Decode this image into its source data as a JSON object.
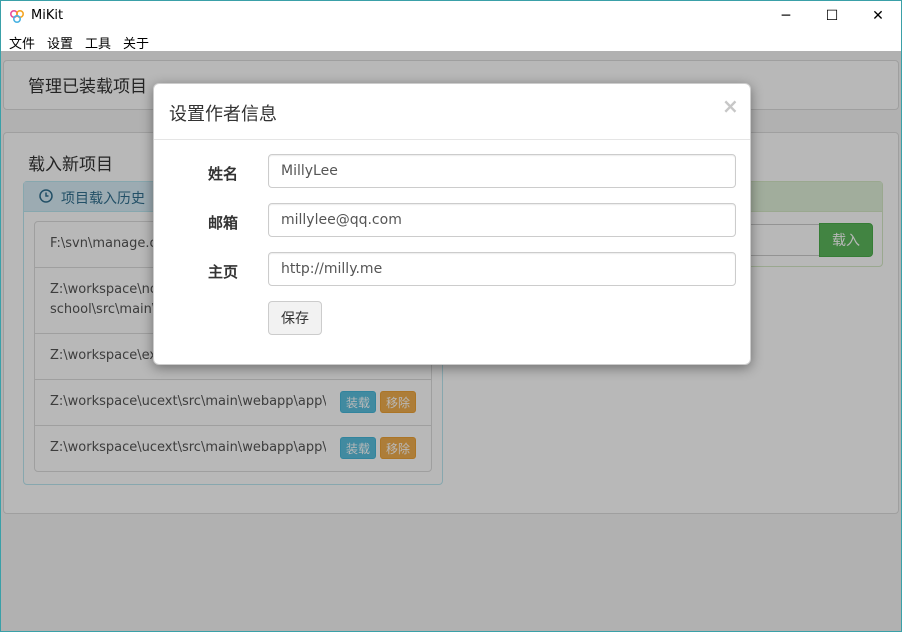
{
  "window": {
    "title": "MiKit",
    "controls": {
      "minimize": "─",
      "maximize": "☐",
      "close": "✕"
    }
  },
  "menubar": {
    "items": [
      "文件",
      "设置",
      "工具",
      "关于"
    ]
  },
  "page": {
    "managed_title": "管理已装载项目",
    "load_new_title": "载入新项目",
    "history_title": "项目载入历史",
    "history_items": [
      {
        "path": "F:\\svn\\manage.o"
      },
      {
        "path": "Z:\\workspace\\nd\nschool\\src\\main\\"
      },
      {
        "path": "Z:\\workspace\\exp"
      },
      {
        "path": "Z:\\workspace\\ucext\\src\\main\\webapp\\app\\ac",
        "load": "装载",
        "remove": "移除"
      },
      {
        "path": "Z:\\workspace\\ucext\\src\\main\\webapp\\app\\ac",
        "load": "装载",
        "remove": "移除"
      }
    ],
    "import_button": "载入"
  },
  "modal": {
    "title": "设置作者信息",
    "close": "×",
    "fields": {
      "name": {
        "label": "姓名",
        "value": "MillyLee"
      },
      "email": {
        "label": "邮箱",
        "value": "millylee@qq.com"
      },
      "homepage": {
        "label": "主页",
        "value": "http://milly.me"
      }
    },
    "save_button": "保存"
  },
  "colors": {
    "window_border": "#3aa0a8",
    "info_head": "#d9edf7",
    "success_head": "#dff0d8",
    "btn_info": "#5bc0de",
    "btn_warning": "#f0ad4e",
    "btn_success": "#5cb85c"
  }
}
